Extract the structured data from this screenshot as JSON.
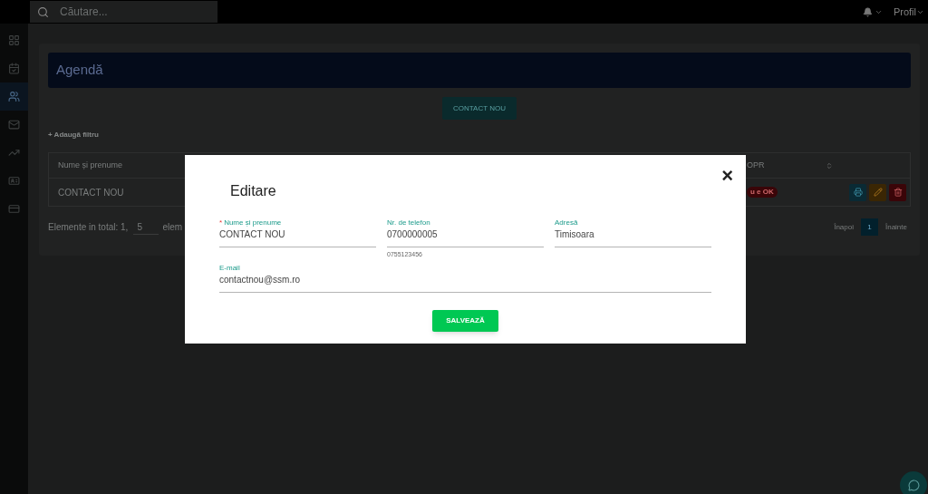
{
  "topbar": {
    "search": {
      "placeholder": "Căutare..."
    },
    "profile": "Profil"
  },
  "sidebar": {
    "items": [
      {
        "selected": false
      },
      {
        "selected": false
      },
      {
        "selected": true
      },
      {
        "selected": false
      },
      {
        "selected": false
      },
      {
        "selected": false
      },
      {
        "selected": false
      }
    ]
  },
  "page": {
    "title": "Agendă",
    "new_button": "CONTACT NOU",
    "add_filter": "+ Adaugă filtru",
    "table": {
      "columns": [
        "Nume și prenume",
        "OPR"
      ],
      "rows": [
        {
          "name": "CONTACT NOU",
          "status": "u e OK"
        }
      ]
    },
    "footer": {
      "total": "Elemente in total: 1,",
      "page_size": "5",
      "suffix": "elem",
      "prev": "Înapoi",
      "page": "1",
      "next": "Înainte"
    }
  },
  "modal": {
    "title": "Editare",
    "close": "×",
    "fields": [
      {
        "label": "Nume și prenume",
        "required": true,
        "required_mark": "*",
        "value": "CONTACT NOU"
      },
      {
        "label": "Nr. de telefon",
        "required": false,
        "value": "0700000005",
        "hint": "0755123456"
      },
      {
        "label": "Adresă",
        "required": false,
        "value": "Timisoara"
      },
      {
        "label": "E-mail",
        "required": false,
        "value": "contactnou@ssm.ro"
      }
    ],
    "save": "SALVEAZĂ"
  }
}
